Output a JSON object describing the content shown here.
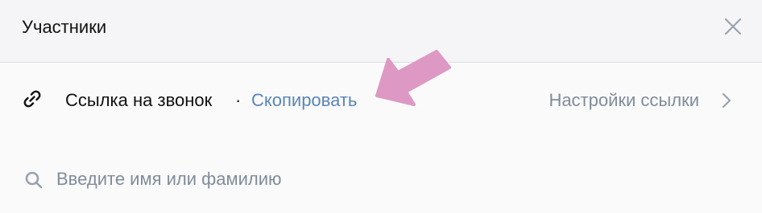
{
  "header": {
    "title": "Участники",
    "close_icon": "close-icon"
  },
  "link_row": {
    "icon": "link-icon",
    "label": "Ссылка на звонок",
    "separator": "·",
    "copy_label": "Скопировать",
    "settings_label": "Настройки ссылки",
    "chevron_icon": "chevron-right-icon"
  },
  "annotation": {
    "icon": "arrow-pointer-icon",
    "color": "#dd99c4"
  },
  "search": {
    "icon": "search-icon",
    "placeholder": "Введите имя или фамилию",
    "value": ""
  },
  "colors": {
    "accent": "#5a85b8",
    "secondary_text": "#818c99",
    "primary_text": "#111111",
    "header_bg": "#f5f5f7",
    "body_bg": "#fafafb"
  }
}
